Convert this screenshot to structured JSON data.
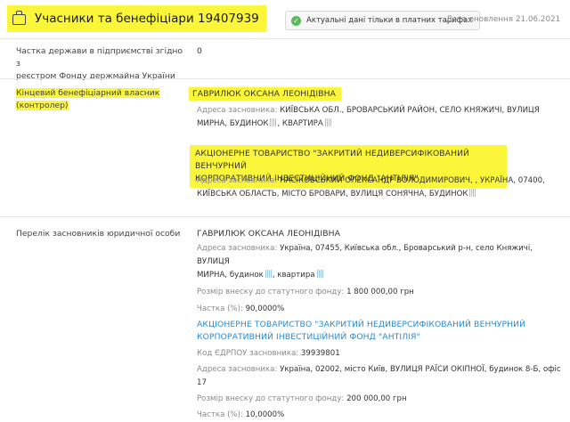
{
  "header": {
    "title": "Учасники та бенефіціари 19407939",
    "badge": "Актуальні дані тільки в платних тарифах",
    "update_date": "Дата оновлення 21.06.2021"
  },
  "state_share": {
    "label_line1": "Частка держави в підприємстві згідно з",
    "label_line2": "реєстром Фонду держмайна України",
    "value": "0"
  },
  "beneficiaries": {
    "label_line1": "Кінцевий бенефіціарний власник",
    "label_line2": "(контролер)",
    "items": [
      {
        "name_line1": "ГАВРИЛЮК ОКСАНА ЛЕОНІДІВНА",
        "address_key": "Адреса засновника:",
        "address_line1": "КИЇВСЬКА ОБЛ., БРОВАРСЬКИЙ РАЙОН, СЕЛО КНЯЖИЧІ, ВУЛИЦЯ",
        "address_line2": "МИРНА, БУДИНОК",
        "address_line2b": ", КВАРТИРА"
      },
      {
        "name_line1": "АКЦІОНЕРНЕ ТОВАРИСТВО \"ЗАКРИТИЙ НЕДИВЕРСИФІКОВАНИЙ ВЕНЧУРНИЙ",
        "name_line2": "КОРПОРАТИВНИЙ ІНВЕСТИЦІЙНИЙ ФОНД \"АНТІЛІЯ\"",
        "address_key": "Адреса засновника:",
        "address_line1": "НАСІКОВСЬКИЙ ОЛЕКСАНДР ВОЛОДИМИРОВИЧ, , УКРАЇНА, 07400,",
        "address_line2": "КИЇВСЬКА ОБЛАСТЬ, МІСТО БРОВАРИ, ВУЛИЦЯ СОНЯЧНА, БУДИНОК"
      }
    ]
  },
  "founders": {
    "label": "Перелік засновників юридичної особи",
    "items": [
      {
        "name_line1": "ГАВРИЛЮК ОКСАНА ЛЕОНІДІВНА",
        "address_key": "Адреса засновника:",
        "address_line1": "Україна, 07455, Київська обл., Броварський р-н, село Княжичі, ВУЛИЦЯ",
        "address_line2": "МИРНА, будинок",
        "address_line2b": ", квартира",
        "capital_key": "Розмір внеску до статутного фонду:",
        "capital_value": "1 800 000,00 грн",
        "share_key": "Частка (%):",
        "share_value": "90,0000%"
      },
      {
        "name_line1": "АКЦІОНЕРНЕ ТОВАРИСТВО \"ЗАКРИТИЙ НЕДИВЕРСИФІКОВАНИЙ ВЕНЧУРНИЙ",
        "name_line2": "КОРПОРАТИВНИЙ ІНВЕСТИЦІЙНИЙ ФОНД \"АНТІЛІЯ\"",
        "code_key": "Код ЄДРПОУ засновника:",
        "code_value": "39939801",
        "address_key": "Адреса засновника:",
        "address_line1": "Україна, 02002, місто Київ, ВУЛИЦЯ РАЇСИ ОКІПНОЇ, будинок 8-Б, офіс 17",
        "capital_key": "Розмір внеску до статутного фонду:",
        "capital_value": "200 000,00 грн",
        "share_key": "Частка (%):",
        "share_value": "10,0000%"
      }
    ]
  },
  "colors": {
    "highlight": "#fbf63a",
    "link": "#2a8ad6",
    "badge_check": "#5cb85c"
  }
}
